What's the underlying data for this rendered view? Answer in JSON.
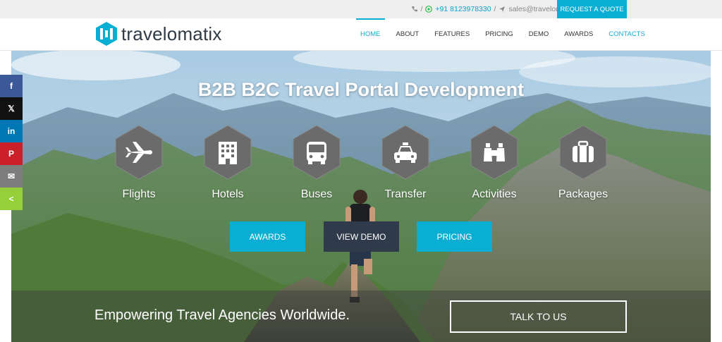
{
  "topbar": {
    "phone": "+91 8123978330",
    "separator": "/",
    "email": "sales@travelomatix.com",
    "request_quote": "REQUEST A QUOTE"
  },
  "brand": {
    "name": "travelomatix",
    "accent": "#0aaed3"
  },
  "nav": {
    "items": [
      {
        "label": "HOME"
      },
      {
        "label": "ABOUT"
      },
      {
        "label": "FEATURES"
      },
      {
        "label": "PRICING"
      },
      {
        "label": "DEMO"
      },
      {
        "label": "AWARDS"
      },
      {
        "label": "CONTACTS"
      }
    ]
  },
  "hero": {
    "title": "B2B B2C Travel Portal Development",
    "services": [
      {
        "label": "Flights",
        "icon": "airplane-icon"
      },
      {
        "label": "Hotels",
        "icon": "building-icon"
      },
      {
        "label": "Buses",
        "icon": "bus-icon"
      },
      {
        "label": "Transfer",
        "icon": "taxi-icon"
      },
      {
        "label": "Activities",
        "icon": "binoculars-icon"
      },
      {
        "label": "Packages",
        "icon": "suitcase-icon"
      }
    ],
    "buttons": {
      "awards": "AWARDS",
      "demo": "VIEW DEMO",
      "pricing": "PRICING"
    },
    "tagline": "Empowering Travel Agencies Worldwide.",
    "talk": "TALK TO US"
  },
  "share": {
    "items": [
      {
        "name": "facebook",
        "glyph": "f",
        "color": "#3b5998"
      },
      {
        "name": "x",
        "glyph": "𝕏",
        "color": "#111111"
      },
      {
        "name": "linkedin",
        "glyph": "in",
        "color": "#0077b5"
      },
      {
        "name": "pinterest",
        "glyph": "P",
        "color": "#cb2027"
      },
      {
        "name": "email",
        "glyph": "✉",
        "color": "#7d7d7d"
      },
      {
        "name": "sharethis",
        "glyph": "<",
        "color": "#95d03a"
      }
    ]
  }
}
